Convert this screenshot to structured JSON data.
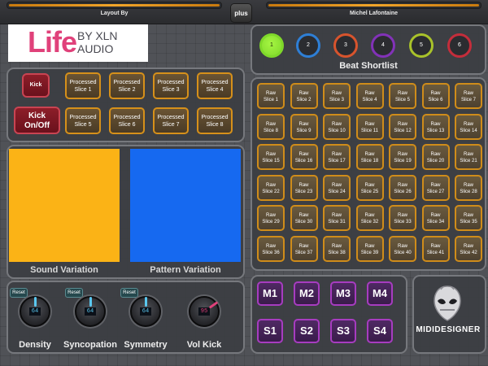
{
  "header": {
    "left_label": "Layout By",
    "right_label": "Michel Lafontaine",
    "center_button": "plus",
    "accent": "#f2a52a"
  },
  "logo": {
    "big": "Life",
    "by": "BY XLN",
    "audio": "AUDIO",
    "color": "#e0417a"
  },
  "beat_shortlist": {
    "title": "Beat Shortlist",
    "items": [
      {
        "label": "1",
        "color": "#7fd82a",
        "active": true
      },
      {
        "label": "2",
        "color": "#2e7fd6"
      },
      {
        "label": "3",
        "color": "#d8542d"
      },
      {
        "label": "4",
        "color": "#8232b8"
      },
      {
        "label": "5",
        "color": "#a9c22a"
      },
      {
        "label": "6",
        "color": "#c42d3b"
      }
    ]
  },
  "kick": {
    "kick_label": "Kick",
    "toggle_label_1": "Kick",
    "toggle_label_2": "On/Off"
  },
  "processed": [
    {
      "l1": "Processed",
      "l2": "Slice 1"
    },
    {
      "l1": "Processed",
      "l2": "Slice 2"
    },
    {
      "l1": "Processed",
      "l2": "Slice 3"
    },
    {
      "l1": "Processed",
      "l2": "Slice 4"
    },
    {
      "l1": "Processed",
      "l2": "Slice 5"
    },
    {
      "l1": "Processed",
      "l2": "Slice 6"
    },
    {
      "l1": "Processed",
      "l2": "Slice 7"
    },
    {
      "l1": "Processed",
      "l2": "Slice 8"
    }
  ],
  "pads": {
    "sound_label": "Sound Variation",
    "sound_color": "#fbb316",
    "pattern_label": "Pattern Variation",
    "pattern_color": "#1669f0"
  },
  "raw_slices": [
    {
      "l1": "Raw",
      "l2": "Slice 1"
    },
    {
      "l1": "Raw",
      "l2": "Slice 2"
    },
    {
      "l1": "Raw",
      "l2": "Slice 3"
    },
    {
      "l1": "Raw",
      "l2": "Slice 4"
    },
    {
      "l1": "Raw",
      "l2": "Slice 5"
    },
    {
      "l1": "Raw",
      "l2": "Slice 6"
    },
    {
      "l1": "Raw",
      "l2": "Slice 7"
    },
    {
      "l1": "Raw",
      "l2": "Slice 8"
    },
    {
      "l1": "Raw",
      "l2": "Slice 9"
    },
    {
      "l1": "Raw",
      "l2": "Slice 10"
    },
    {
      "l1": "Raw",
      "l2": "Slice 11"
    },
    {
      "l1": "Raw",
      "l2": "Slice 12"
    },
    {
      "l1": "Raw",
      "l2": "Slice 13"
    },
    {
      "l1": "Raw",
      "l2": "Slice 14"
    },
    {
      "l1": "Raw",
      "l2": "Slice 15"
    },
    {
      "l1": "Raw",
      "l2": "Slice 16"
    },
    {
      "l1": "Raw",
      "l2": "Slice 17"
    },
    {
      "l1": "Raw",
      "l2": "Slice 18"
    },
    {
      "l1": "Raw",
      "l2": "Slice 19"
    },
    {
      "l1": "Raw",
      "l2": "Slice 20"
    },
    {
      "l1": "Raw",
      "l2": "Slice 21"
    },
    {
      "l1": "Raw",
      "l2": "Slice 22"
    },
    {
      "l1": "Raw",
      "l2": "Slice 23"
    },
    {
      "l1": "Raw",
      "l2": "Slice 24"
    },
    {
      "l1": "Raw",
      "l2": "Slice 25"
    },
    {
      "l1": "Raw",
      "l2": "Slice 26"
    },
    {
      "l1": "Raw",
      "l2": "Slice 27"
    },
    {
      "l1": "Raw",
      "l2": "Slice 28"
    },
    {
      "l1": "Raw",
      "l2": "Slice 29"
    },
    {
      "l1": "Raw",
      "l2": "Slice 30"
    },
    {
      "l1": "Raw",
      "l2": "Slice 31"
    },
    {
      "l1": "Raw",
      "l2": "Slice 32"
    },
    {
      "l1": "Raw",
      "l2": "Slice 33"
    },
    {
      "l1": "Raw",
      "l2": "Slice 34"
    },
    {
      "l1": "Raw",
      "l2": "Slice 35"
    },
    {
      "l1": "Raw",
      "l2": "Slice 36"
    },
    {
      "l1": "Raw",
      "l2": "Slice 37"
    },
    {
      "l1": "Raw",
      "l2": "Slice 38"
    },
    {
      "l1": "Raw",
      "l2": "Slice 39"
    },
    {
      "l1": "Raw",
      "l2": "Slice 40"
    },
    {
      "l1": "Raw",
      "l2": "Slice 41"
    },
    {
      "l1": "Raw",
      "l2": "Slice 42"
    }
  ],
  "knobs": [
    {
      "label": "Density",
      "value": "64",
      "reset": "Reset",
      "color": "#5ac8f0"
    },
    {
      "label": "Syncopation",
      "value": "64",
      "reset": "Reset",
      "color": "#5ac8f0"
    },
    {
      "label": "Symmetry",
      "value": "64",
      "reset": "Reset",
      "color": "#5ac8f0"
    },
    {
      "label": "Vol Kick",
      "value": "95",
      "color": "#e0417a"
    }
  ],
  "mutes": [
    "M1",
    "M2",
    "M3",
    "M4"
  ],
  "solos": [
    "S1",
    "S2",
    "S3",
    "S4"
  ],
  "branding": {
    "text": "MIDIDESIGNER",
    "icon": "alien-head-icon"
  }
}
